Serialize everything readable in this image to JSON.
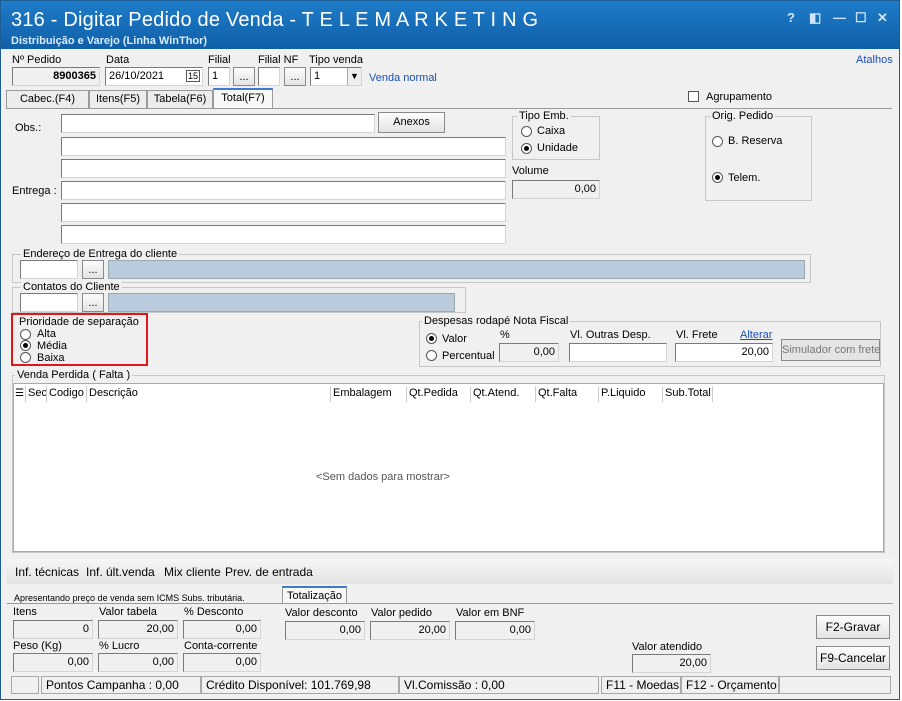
{
  "window": {
    "title": "316 - Digitar Pedido de Venda - T E L E M A R K E T I N G",
    "subtitle": "Distribuição e Varejo (Linha WinThor)",
    "help": "?",
    "restore": "◧",
    "minimize": "—",
    "maximize": "☐",
    "close": "✕"
  },
  "header": {
    "atalhos": "Atalhos",
    "pedido_label": "Nº Pedido",
    "pedido_value": "8900365",
    "data_label": "Data",
    "data_value": "26/10/2021",
    "cal_icon": "15",
    "filial_label": "Filial",
    "filial_value": "1",
    "filialnf_label": "Filial NF",
    "filialnf_value": "",
    "tipo_label": "Tipo venda",
    "tipo_value": "1",
    "tipo_desc": "Venda normal",
    "ellipsis": "..."
  },
  "tabs": [
    {
      "label": "Cabec.(F4)"
    },
    {
      "label": "Itens(F5)"
    },
    {
      "label": "Tabela(F6)"
    },
    {
      "label": "Total(F7)"
    }
  ],
  "agrupamento": "Agrupamento",
  "obs": {
    "label": "Obs.:",
    "anexos": "Anexos",
    "entrega_label": "Entrega :"
  },
  "tipo_emb": {
    "title": "Tipo Emb.",
    "caixa": "Caixa",
    "unidade": "Unidade",
    "volume_label": "Volume",
    "volume_value": "0,00"
  },
  "orig_pedido": {
    "title": "Orig. Pedido",
    "reserva": "B. Reserva",
    "telem": "Telem."
  },
  "endereco": {
    "title": "Endereço de Entrega do cliente"
  },
  "contatos": {
    "title": "Contatos do Cliente"
  },
  "prioridade": {
    "title": "Prioridade de separação",
    "alta": "Alta",
    "media": "Média",
    "baixa": "Baixa"
  },
  "despesas": {
    "title": "Despesas rodapé Nota Fiscal",
    "valor": "Valor",
    "percentual": "Percentual",
    "pct_label": "%",
    "pct_value": "0,00",
    "outras_label": "Vl. Outras Desp.",
    "outras_value": "",
    "frete_label": "Vl. Frete",
    "frete_value": "20,00",
    "alterar": "Alterar",
    "simulador": "Simulador com frete"
  },
  "venda_perdida": {
    "title": "Venda Perdida ( Falta )",
    "columns": [
      "Sec",
      "Codigo",
      "Descrição",
      "Embalagem",
      "Qt.Pedida",
      "Qt.Atend.",
      "Qt.Falta",
      "P.Liquido",
      "Sub.Total"
    ],
    "empty": "<Sem dados para mostrar>"
  },
  "bottom_links": [
    "Inf. técnicas",
    "Inf. últ.venda",
    "Mix cliente",
    "Prev. de entrada"
  ],
  "totals": {
    "note": "Apresentando preço de venda sem ICMS Subs. tributária.",
    "tab": "Totalização",
    "itens_label": "Itens",
    "itens_value": "0",
    "valor_tabela_label": "Valor tabela",
    "valor_tabela_value": "20,00",
    "desconto_label": "% Desconto",
    "desconto_value": "0,00",
    "peso_label": "Peso (Kg)",
    "peso_value": "0,00",
    "lucro_label": "% Lucro",
    "lucro_value": "0,00",
    "cc_label": "Conta-corrente",
    "cc_value": "0,00",
    "valor_desconto_label": "Valor desconto",
    "valor_desconto_value": "0,00",
    "valor_pedido_label": "Valor pedido",
    "valor_pedido_value": "20,00",
    "bnf_label": "Valor em BNF",
    "bnf_value": "0,00",
    "atendido_label": "Valor atendido",
    "atendido_value": "20,00",
    "gravar": "F2-Gravar",
    "cancelar": "F9-Cancelar"
  },
  "status": {
    "pontos": "Pontos Campanha : 0,00",
    "credito": "Crédito Disponível: 101.769,98",
    "comissao": "Vl.Comissão : 0,00",
    "moedas": "F11 - Moedas",
    "orcamento": "F12 - Orçamento"
  }
}
